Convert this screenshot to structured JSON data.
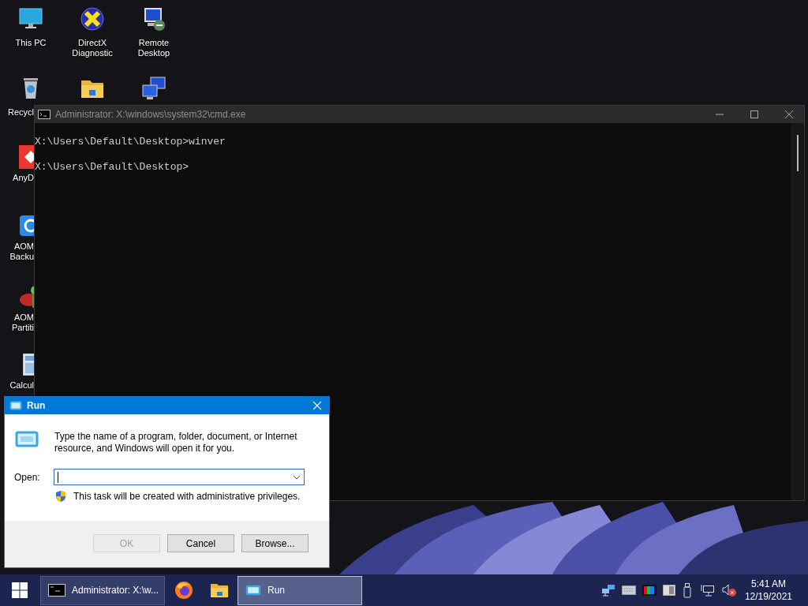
{
  "desktop_icons": [
    {
      "kind": "monitor",
      "lines": [
        "This PC"
      ]
    },
    {
      "kind": "crossball",
      "lines": [
        "DirectX",
        "Diagnostic"
      ]
    },
    {
      "kind": "remote",
      "lines": [
        "Remote",
        "Desktop"
      ]
    },
    {
      "kind": "bin",
      "lines": [
        "Recycl"
      ]
    },
    {
      "kind": "folder"
    },
    {
      "kind": "network"
    },
    {
      "kind": "diamond",
      "lines": [
        "AnyD"
      ]
    },
    {
      "kind": "sync",
      "lines": [
        "AOM",
        "Backu"
      ]
    },
    {
      "kind": "pie",
      "lines": [
        "AOM",
        "Partiti"
      ]
    },
    {
      "kind": "calculator",
      "lines": [
        "Calcul"
      ]
    }
  ],
  "cmd_window": {
    "title": "Administrator: X:\\windows\\system32\\cmd.exe",
    "active": false,
    "lines": [
      "X:\\Users\\Default\\Desktop>winver",
      "X:\\Users\\Default\\Desktop>"
    ]
  },
  "run_dialog": {
    "title": "Run",
    "description": "Type the name of a program, folder, document, or Internet resource, and Windows will open it for you.",
    "open_label": "Open:",
    "open_field": {
      "focused": true
    },
    "admin_note": "This task will be created with administrative privileges.",
    "buttons": [
      {
        "label": "OK",
        "disabled": true
      },
      {
        "label": "Cancel",
        "disabled": false
      },
      {
        "label": "Browse...",
        "disabled": false
      }
    ]
  },
  "taskbar": {
    "apps": [
      {
        "kind": "window",
        "label": "Administrator: X:\\w...",
        "selected": false
      },
      {
        "kind": "pinned"
      },
      {
        "kind": "pinned"
      },
      {
        "kind": "window",
        "label": "Run",
        "selected": true
      }
    ],
    "tray": {
      "volume_muted": true
    },
    "clock": {
      "time": "5:41 AM",
      "date": "12/19/2021"
    }
  }
}
